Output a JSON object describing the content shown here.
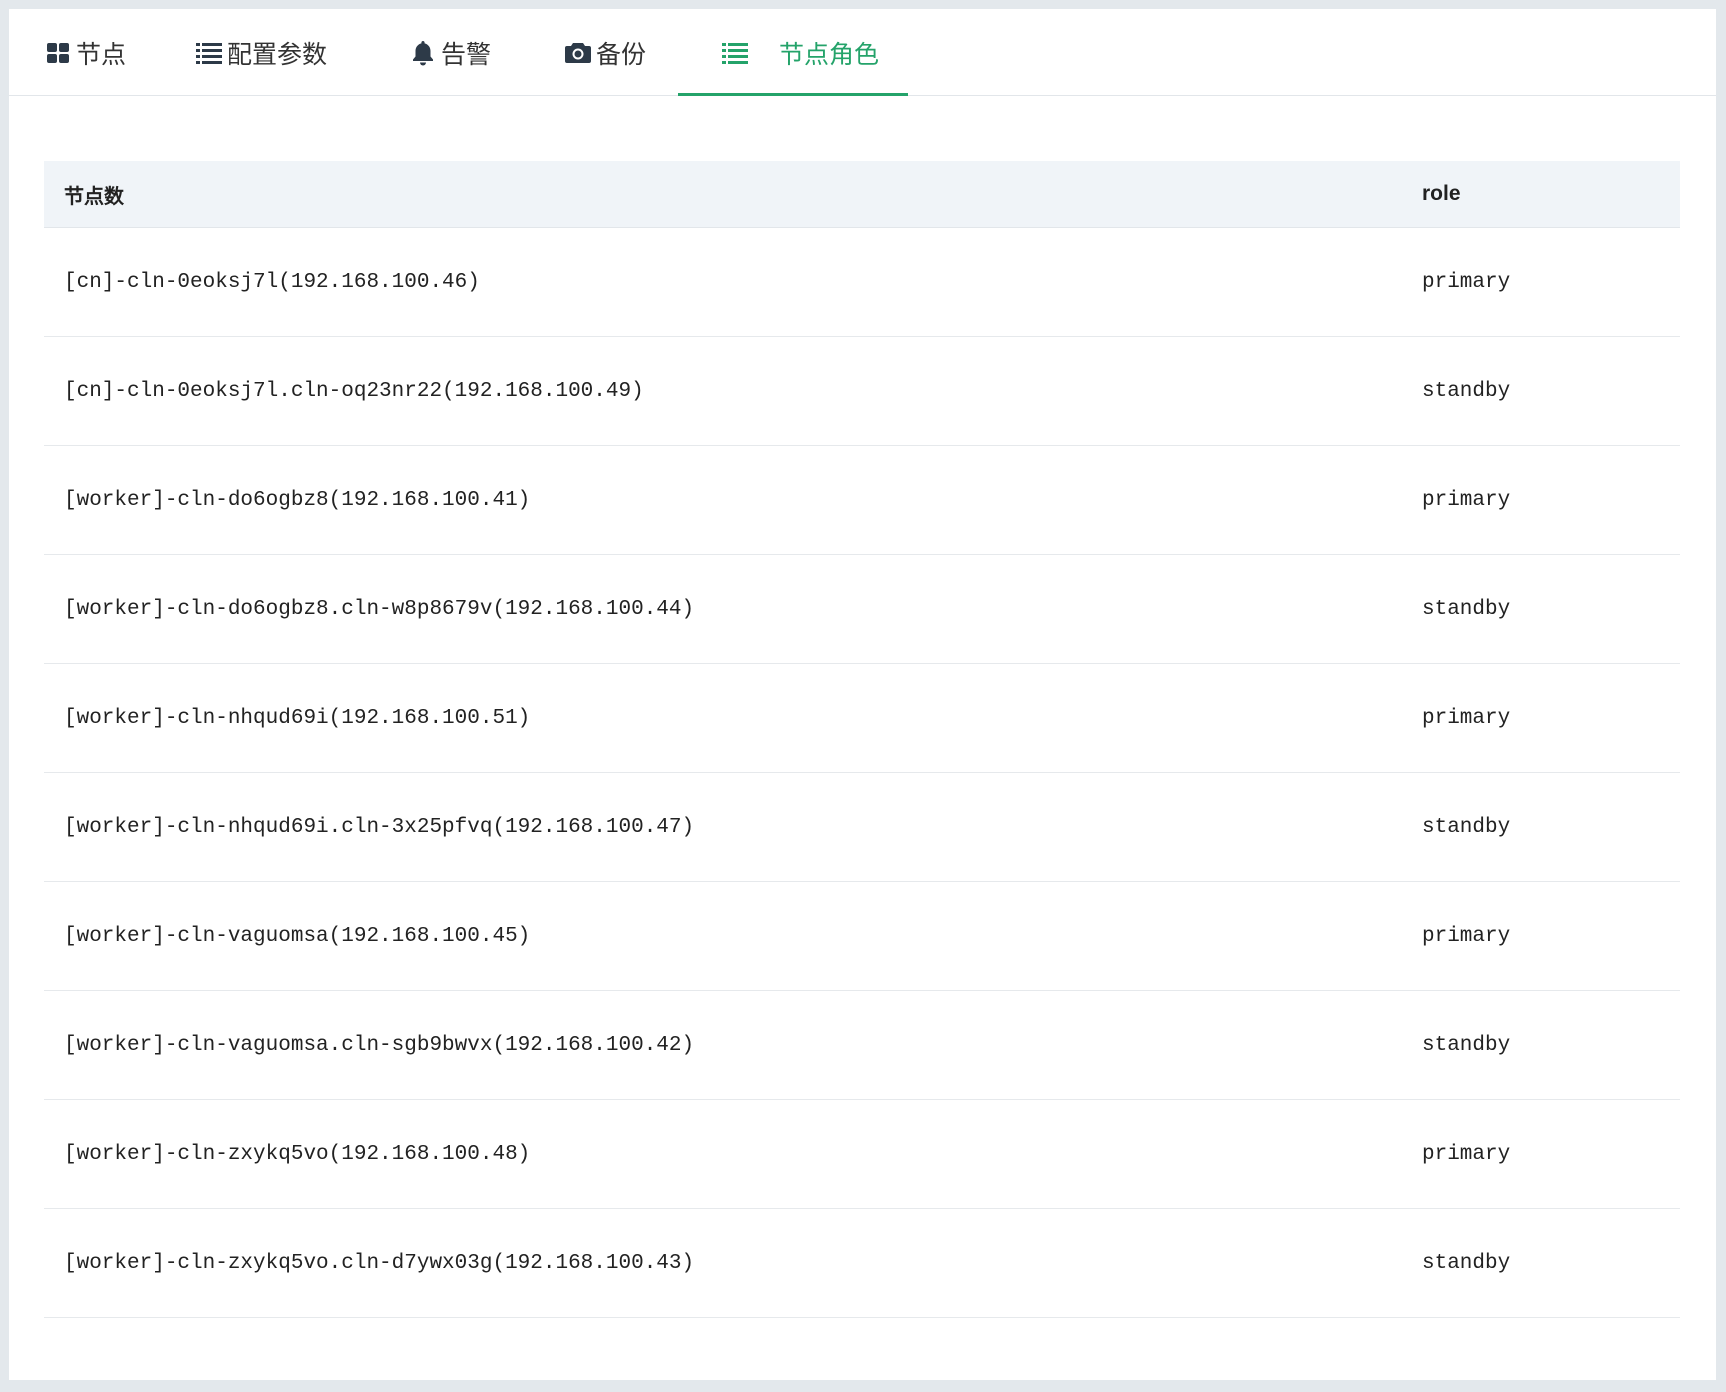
{
  "tabs": [
    {
      "label": "节点",
      "icon": "grid-icon"
    },
    {
      "label": "配置参数",
      "icon": "list-icon"
    },
    {
      "label": "告警",
      "icon": "bell-icon"
    },
    {
      "label": "备份",
      "icon": "camera-icon"
    },
    {
      "label": "节点角色",
      "icon": "list-icon",
      "active": true
    }
  ],
  "accent_color": "#24a36a",
  "table": {
    "headers": {
      "node": "节点数",
      "role": "role"
    },
    "rows": [
      {
        "node": "[cn]-cln-0eoksj7l(192.168.100.46)",
        "role": "primary"
      },
      {
        "node": "[cn]-cln-0eoksj7l.cln-oq23nr22(192.168.100.49)",
        "role": "standby"
      },
      {
        "node": "[worker]-cln-do6ogbz8(192.168.100.41)",
        "role": "primary"
      },
      {
        "node": "[worker]-cln-do6ogbz8.cln-w8p8679v(192.168.100.44)",
        "role": "standby"
      },
      {
        "node": "[worker]-cln-nhqud69i(192.168.100.51)",
        "role": "primary"
      },
      {
        "node": "[worker]-cln-nhqud69i.cln-3x25pfvq(192.168.100.47)",
        "role": "standby"
      },
      {
        "node": "[worker]-cln-vaguomsa(192.168.100.45)",
        "role": "primary"
      },
      {
        "node": "[worker]-cln-vaguomsa.cln-sgb9bwvx(192.168.100.42)",
        "role": "standby"
      },
      {
        "node": "[worker]-cln-zxykq5vo(192.168.100.48)",
        "role": "primary"
      },
      {
        "node": "[worker]-cln-zxykq5vo.cln-d7ywx03g(192.168.100.43)",
        "role": "standby"
      }
    ]
  }
}
